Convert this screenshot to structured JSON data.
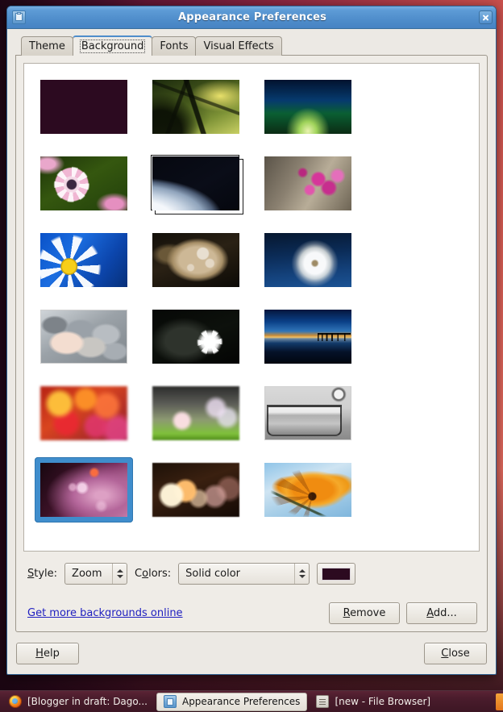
{
  "window": {
    "title": "Appearance Preferences",
    "icon": "preferences-desktop-theme-icon",
    "close_icon": "close-icon"
  },
  "tabs": [
    {
      "label": "Theme",
      "active": false
    },
    {
      "label": "Background",
      "active": true
    },
    {
      "label": "Fonts",
      "active": false
    },
    {
      "label": "Visual Effects",
      "active": false
    }
  ],
  "wallpapers": [
    {
      "name": "solid-color-dark-purple",
      "art": "wp-solid-purple",
      "bordered": false,
      "selected": false,
      "slideshow": false
    },
    {
      "name": "tree-canopy-green",
      "art": "wp-tree",
      "bordered": false,
      "selected": false,
      "slideshow": false
    },
    {
      "name": "green-road-night",
      "art": "wp-road",
      "bordered": false,
      "selected": false,
      "slideshow": false
    },
    {
      "name": "pink-white-daisy",
      "art": "wp-daisy-pink",
      "bordered": false,
      "selected": false,
      "slideshow": false
    },
    {
      "name": "earth-from-space-slideshow",
      "art": "wp-earth",
      "bordered": false,
      "selected": false,
      "slideshow": true
    },
    {
      "name": "pink-blossoms",
      "art": "wp-pink-flowers",
      "bordered": false,
      "selected": false,
      "slideshow": false
    },
    {
      "name": "white-daisy-blue-sky",
      "art": "wp-daisy-blue",
      "bordered": false,
      "selected": false,
      "slideshow": false
    },
    {
      "name": "dry-leaf-dewdrops",
      "art": "wp-leaf",
      "bordered": false,
      "selected": false,
      "slideshow": false
    },
    {
      "name": "dandelion-blue-sky",
      "art": "wp-dandelion",
      "bordered": false,
      "selected": false,
      "slideshow": false
    },
    {
      "name": "grey-pebbles",
      "art": "wp-pebbles",
      "bordered": true,
      "selected": false,
      "slideshow": false
    },
    {
      "name": "white-flower-black-background",
      "art": "wp-white-flower",
      "bordered": false,
      "selected": false,
      "slideshow": false
    },
    {
      "name": "pier-at-dusk",
      "art": "wp-pier",
      "bordered": false,
      "selected": false,
      "slideshow": false
    },
    {
      "name": "red-orange-bokeh",
      "art": "wp-bokeh-red",
      "bordered": false,
      "selected": false,
      "slideshow": false
    },
    {
      "name": "grass-bokeh",
      "art": "wp-grass-bokeh",
      "bordered": false,
      "selected": false,
      "slideshow": false
    },
    {
      "name": "glass-of-water-monochrome",
      "art": "wp-glass",
      "bordered": true,
      "selected": false,
      "slideshow": false
    },
    {
      "name": "ubuntu-warty-final-purple",
      "art": "wp-ubuntu-fix",
      "bordered": false,
      "selected": true,
      "slideshow": false
    },
    {
      "name": "night-bokeh-lights",
      "art": "wp-bokeh-night",
      "bordered": false,
      "selected": false,
      "slideshow": false
    },
    {
      "name": "orange-cosmos-flower",
      "art": "wp-orange-flower",
      "bordered": false,
      "selected": false,
      "slideshow": false
    }
  ],
  "options": {
    "style_label": "Style:",
    "style_label_mnemonic": "S",
    "style_value": "Zoom",
    "style_options": [
      "Zoom"
    ],
    "colors_label": "Colors:",
    "colors_label_mnemonic": "o",
    "colors_value": "Solid color",
    "colors_options": [
      "Solid color"
    ],
    "swatch_color": "#2c0a20"
  },
  "links": {
    "more_backgrounds": "Get more backgrounds online"
  },
  "buttons": {
    "remove": "Remove",
    "remove_mnemonic": "R",
    "add": "Add...",
    "add_mnemonic": "A",
    "help": "Help",
    "help_mnemonic": "H",
    "close": "Close",
    "close_mnemonic": "C"
  },
  "taskbar": {
    "items": [
      {
        "label": "[Blogger in draft: Dago...",
        "icon": "firefox-icon",
        "active": false
      },
      {
        "label": "Appearance Preferences",
        "icon": "preferences-desktop-theme-icon",
        "active": true
      },
      {
        "label": "[new - File Browser]",
        "icon": "file-browser-icon",
        "active": false
      }
    ]
  },
  "colors": {
    "titlebar_blue": "#4f8dcb",
    "selection_blue": "#3f8dcc",
    "window_bg": "#ece9e4",
    "link_blue": "#2020c0",
    "desktop_gradient_start": "#3a0c22",
    "desktop_gradient_end": "#e8746a"
  }
}
